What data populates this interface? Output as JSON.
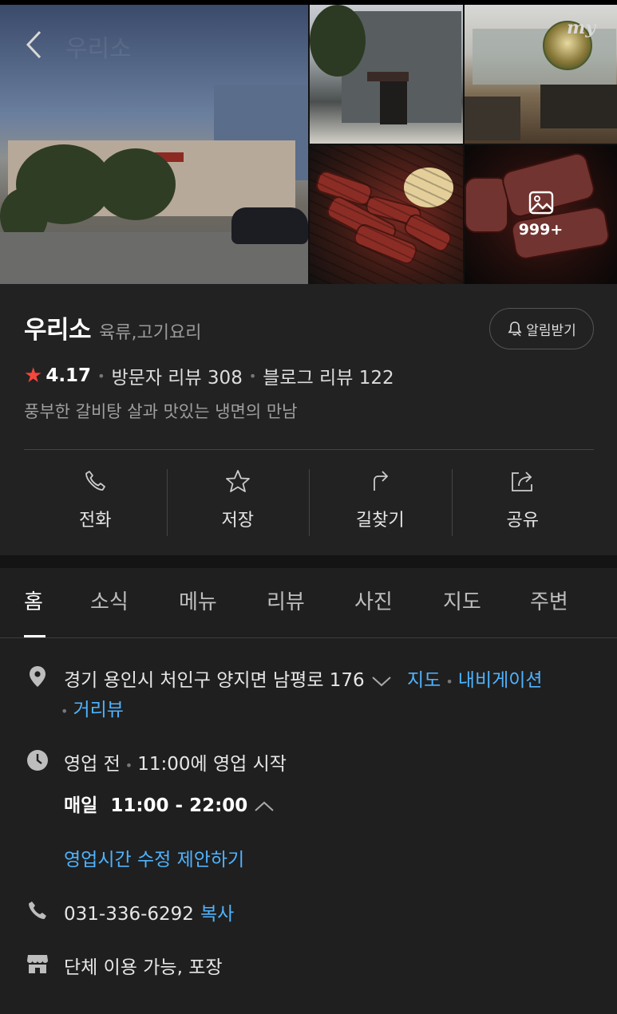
{
  "header": {
    "ghost_title": "우리소",
    "my_label": "my",
    "more_photos_count": "999+"
  },
  "place": {
    "name": "우리소",
    "category": "육류,고기요리",
    "alert_label": "알림받기",
    "rating": "4.17",
    "visitor_reviews": "방문자 리뷰 308",
    "blog_reviews": "블로그 리뷰 122",
    "description": "풍부한 갈비탕 살과 맛있는 냉면의 만남"
  },
  "actions": [
    {
      "label": "전화",
      "icon": "phone-icon"
    },
    {
      "label": "저장",
      "icon": "star-icon"
    },
    {
      "label": "길찾기",
      "icon": "directions-icon"
    },
    {
      "label": "공유",
      "icon": "share-icon"
    }
  ],
  "tabs": [
    "홈",
    "소식",
    "메뉴",
    "리뷰",
    "사진",
    "지도",
    "주변"
  ],
  "active_tab": "홈",
  "details": {
    "address": "경기 용인시 처인구 양지면 남평로 176",
    "map_link": "지도",
    "navigation_link": "내비게이션",
    "streetview_link": "거리뷰",
    "status": "영업 전",
    "status_detail": "11:00에 영업 시작",
    "days": "매일",
    "hours": "11:00 - 22:00",
    "suggest_hours": "영업시간 수정 제안하기",
    "phone": "031-336-6292",
    "copy_label": "복사",
    "amenities": "단체 이용 가능, 포장"
  },
  "colors": {
    "link": "#4fb3ff",
    "star": "#f4473d",
    "background": "#1f1f1f"
  }
}
